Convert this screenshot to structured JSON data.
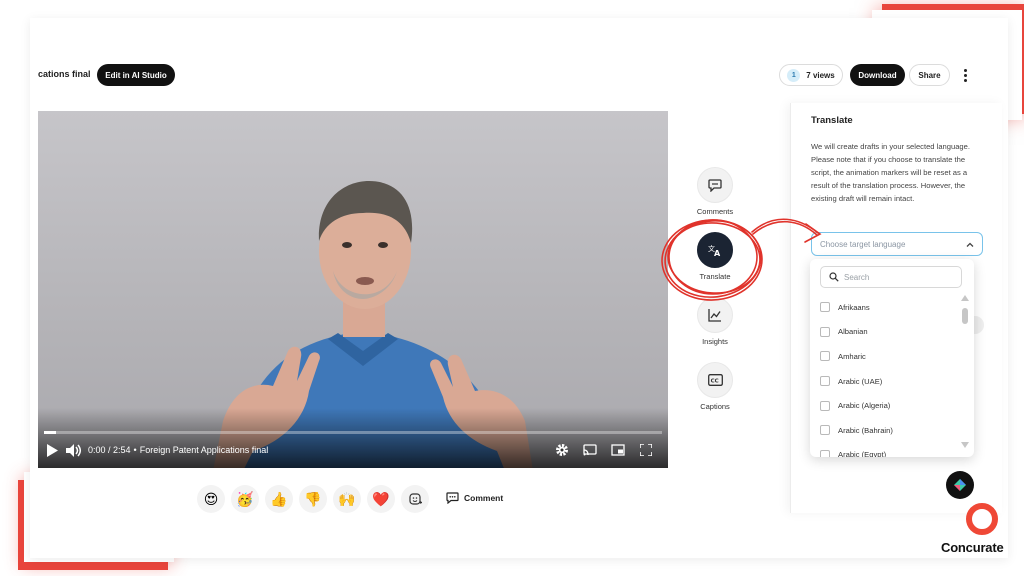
{
  "header": {
    "title": "cations final",
    "edit_label": "Edit in AI Studio",
    "views_badge": "1",
    "views_label": "7 views",
    "download_label": "Download",
    "share_label": "Share"
  },
  "video": {
    "time": "0:00 / 2:54",
    "separator": "•",
    "title": "Foreign Patent Applications final",
    "progress": 0.02
  },
  "reactions": [
    {
      "icon": "heart-eyes-icon",
      "glyph": "😍"
    },
    {
      "icon": "party-face-icon",
      "glyph": "🥳"
    },
    {
      "icon": "thumbs-up-icon",
      "glyph": "👍"
    },
    {
      "icon": "thumbs-down-icon",
      "glyph": "👎"
    },
    {
      "icon": "raised-hands-icon",
      "glyph": "🙌"
    },
    {
      "icon": "heart-icon",
      "glyph": "❤️"
    }
  ],
  "comment_label": "Comment",
  "side_actions": {
    "comments": "Comments",
    "translate": "Translate",
    "insights": "Insights",
    "captions": "Captions"
  },
  "translate_panel": {
    "title": "Translate",
    "description": "We will create drafts in your selected language. Please note that if you choose to translate the script, the animation markers will be reset as a result of the translation process. However, the existing draft will remain intact.",
    "select_placeholder": "Choose target language",
    "search_placeholder": "Search",
    "languages": [
      "Afrikaans",
      "Albanian",
      "Amharic",
      "Arabic (UAE)",
      "Arabic (Algeria)",
      "Arabic (Bahrain)",
      "Arabic (Egypt)"
    ]
  },
  "brand": {
    "name": "Concurate",
    "accent": "#ef4836"
  }
}
